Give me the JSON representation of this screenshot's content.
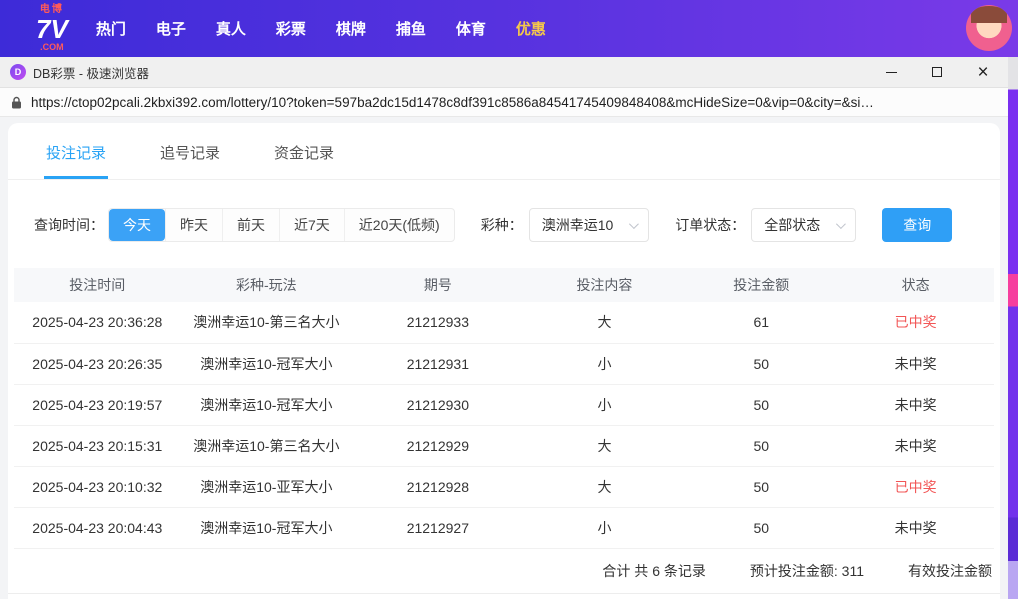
{
  "site_nav": {
    "logo": {
      "badge": "电博",
      "main": "7V",
      "sub": ".COM"
    },
    "items": [
      {
        "key": "hot",
        "label": "热门"
      },
      {
        "key": "slots",
        "label": "电子"
      },
      {
        "key": "live",
        "label": "真人"
      },
      {
        "key": "lottery",
        "label": "彩票"
      },
      {
        "key": "cards",
        "label": "棋牌"
      },
      {
        "key": "fishing",
        "label": "捕鱼"
      },
      {
        "key": "sports",
        "label": "体育"
      },
      {
        "key": "promo",
        "label": "优惠",
        "highlight": true
      }
    ]
  },
  "browser": {
    "app_icon_letter": "D",
    "title": "DB彩票 - 极速浏览器",
    "url": "https://ctop02pcali.2kbxi392.com/lottery/10?token=597ba2dc15d1478c8df391c8586a84541745409848408&mcHideSize=0&vip=0&city=&si…"
  },
  "tabs": [
    {
      "key": "bet-records",
      "label": "投注记录",
      "active": true
    },
    {
      "key": "chase-records",
      "label": "追号记录",
      "active": false
    },
    {
      "key": "fund-records",
      "label": "资金记录",
      "active": false
    }
  ],
  "filters": {
    "time_label": "查询时间：",
    "time_options": [
      {
        "label": "今天",
        "active": true
      },
      {
        "label": "昨天",
        "active": false
      },
      {
        "label": "前天",
        "active": false
      },
      {
        "label": "近7天",
        "active": false
      },
      {
        "label": "近20天(低频)",
        "active": false
      }
    ],
    "lottery_label": "彩种：",
    "lottery_value": "澳洲幸运10",
    "status_label": "订单状态：",
    "status_value": "全部状态",
    "query_button": "查询"
  },
  "table": {
    "headers": [
      "投注时间",
      "彩种-玩法",
      "期号",
      "投注内容",
      "投注金额",
      "状态"
    ],
    "rows": [
      {
        "time": "2025-04-23 20:36:28",
        "play": "澳洲幸运10-第三名大小",
        "issue": "21212933",
        "content": "大",
        "amount": "61",
        "status": "已中奖",
        "won": true
      },
      {
        "time": "2025-04-23 20:26:35",
        "play": "澳洲幸运10-冠军大小",
        "issue": "21212931",
        "content": "小",
        "amount": "50",
        "status": "未中奖",
        "won": false
      },
      {
        "time": "2025-04-23 20:19:57",
        "play": "澳洲幸运10-冠军大小",
        "issue": "21212930",
        "content": "小",
        "amount": "50",
        "status": "未中奖",
        "won": false
      },
      {
        "time": "2025-04-23 20:15:31",
        "play": "澳洲幸运10-第三名大小",
        "issue": "21212929",
        "content": "大",
        "amount": "50",
        "status": "未中奖",
        "won": false
      },
      {
        "time": "2025-04-23 20:10:32",
        "play": "澳洲幸运10-亚军大小",
        "issue": "21212928",
        "content": "大",
        "amount": "50",
        "status": "已中奖",
        "won": true
      },
      {
        "time": "2025-04-23 20:04:43",
        "play": "澳洲幸运10-冠军大小",
        "issue": "21212927",
        "content": "小",
        "amount": "50",
        "status": "未中奖",
        "won": false
      }
    ],
    "summary": {
      "total": "合计 共 6 条记录",
      "expected": "预计投注金额: 311",
      "valid": "有效投注金额"
    }
  }
}
